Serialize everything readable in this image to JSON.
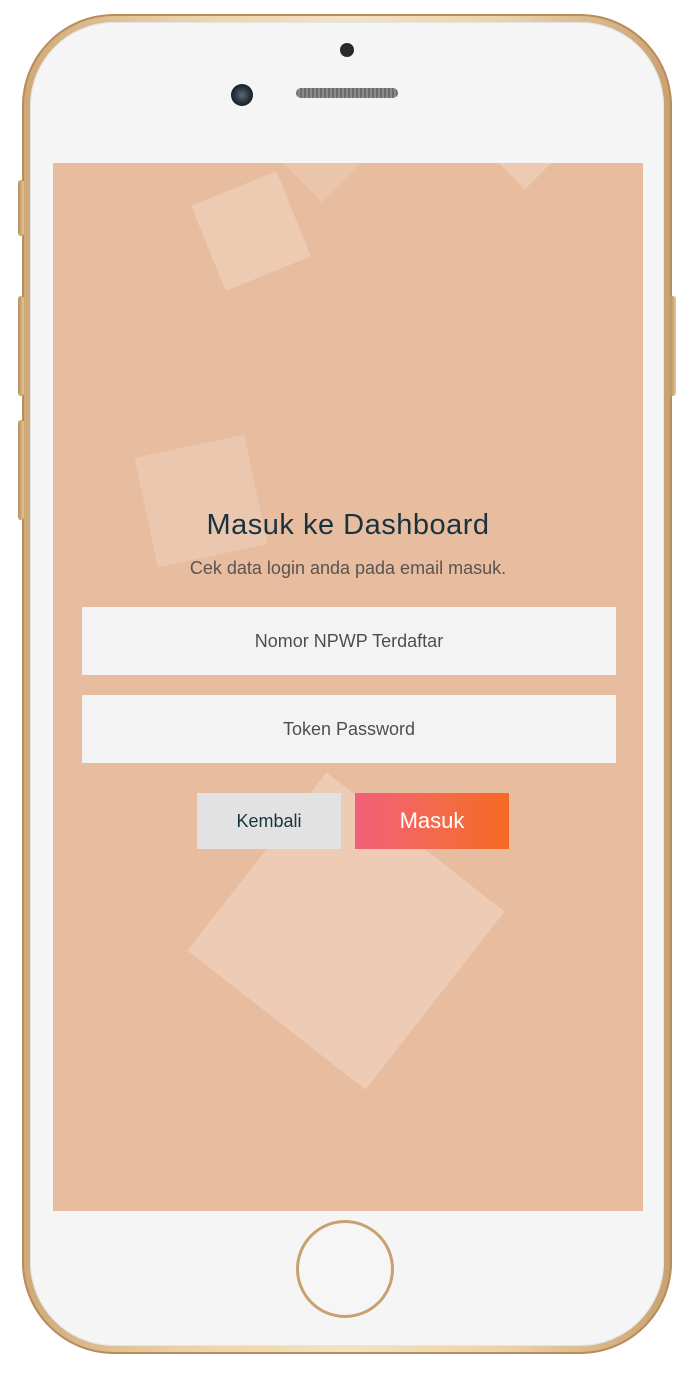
{
  "login": {
    "title": "Masuk ke Dashboard",
    "subtitle": "Cek data login anda pada email masuk.",
    "npwp_placeholder": "Nomor NPWP Terdaftar",
    "npwp_value": "",
    "token_placeholder": "Token Password",
    "token_value": "",
    "back_label": "Kembali",
    "submit_label": "Masuk"
  },
  "colors": {
    "screen_background": "#e7bc9f",
    "title_color": "#18333d",
    "submit_gradient_start": "#f25f7a",
    "submit_gradient_end": "#f56a22",
    "back_button": "#e2e2e2",
    "phone_frame": "#d8b888"
  }
}
